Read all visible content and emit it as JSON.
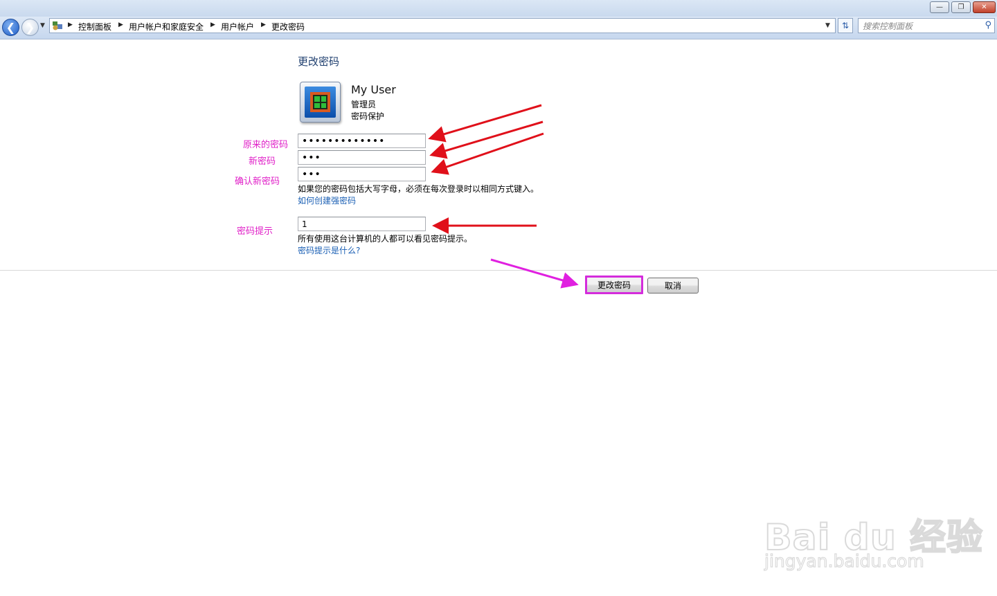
{
  "window": {
    "minimize_glyph": "—",
    "restore_glyph": "❐",
    "close_glyph": "✕"
  },
  "nav": {
    "back_glyph": "❮",
    "forward_glyph": "❯",
    "breadcrumbs": [
      "控制面板",
      "用户帐户和家庭安全",
      "用户帐户",
      "更改密码"
    ],
    "search_placeholder": "搜索控制面板",
    "icons": [
      "back-arrow-icon",
      "forward-arrow-icon",
      "control-panel-icon",
      "refresh-icon",
      "search-icon"
    ]
  },
  "page": {
    "title": "更改密码",
    "user": {
      "name": "My User",
      "role": "管理员",
      "status": "密码保护"
    }
  },
  "form": {
    "current_password": {
      "label": "原来的密码",
      "value": "•••••••••••••"
    },
    "new_password": {
      "label": "新密码",
      "value": "•••"
    },
    "confirm_password": {
      "label": "确认新密码",
      "value": "•••"
    },
    "caps_note": "如果您的密码包括大写字母，必须在每次登录时以相同方式键入。",
    "strong_link": "如何创建强密码",
    "hint": {
      "label": "密码提示",
      "value": "1"
    },
    "hint_note": "所有使用这台计算机的人都可以看见密码提示。",
    "hint_link": "密码提示是什么?"
  },
  "buttons": {
    "change": "更改密码",
    "cancel": "取消"
  },
  "colors": {
    "annotation_red": "#e0101a",
    "annotation_magenta": "#e020e0",
    "link": "#1a5fb4"
  },
  "watermark": {
    "brand": "Bai du 经验",
    "url": "jingyan.baidu.com"
  }
}
